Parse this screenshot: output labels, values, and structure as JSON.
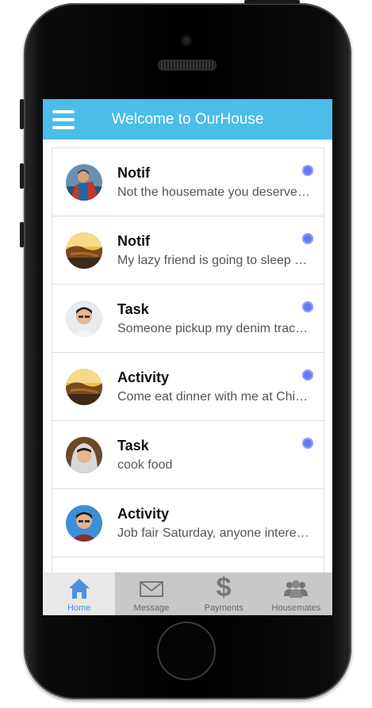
{
  "header": {
    "title": "Welcome to OurHouse"
  },
  "feed": [
    {
      "title": "Notif",
      "message": "Not the housemate you deserve, but the one you need",
      "unread": true
    },
    {
      "title": "Notif",
      "message": "My lazy friend is going to sleep on the couch tonight",
      "unread": true
    },
    {
      "title": "Task",
      "message": "Someone pickup my denim tracksuit from the cleaners",
      "unread": true
    },
    {
      "title": "Activity",
      "message": "Come eat dinner with me at Chipotle tonight",
      "unread": true
    },
    {
      "title": "Task",
      "message": "cook food",
      "unread": true
    },
    {
      "title": "Activity",
      "message": "Job fair Saturday, anyone interested?",
      "unread": false
    }
  ],
  "tabs": [
    {
      "label": "Home",
      "icon": "home-icon",
      "active": true
    },
    {
      "label": "Message",
      "icon": "envelope-icon",
      "active": false
    },
    {
      "label": "Payments",
      "icon": "dollar-icon",
      "active": false
    },
    {
      "label": "Housemates",
      "icon": "people-icon",
      "active": false
    }
  ],
  "colors": {
    "header": "#4bbde9",
    "unread_dot": "#6478f0",
    "active_tab": "#4a90e2",
    "tabbar": "#c8c8c8"
  }
}
